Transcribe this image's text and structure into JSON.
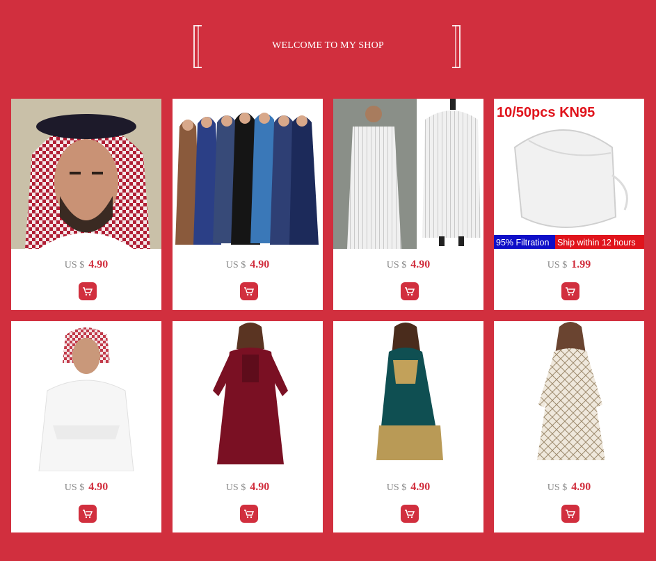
{
  "header": {
    "title": "WELCOME TO MY SHOP"
  },
  "products": [
    {
      "currency": "US $",
      "price": "4.90",
      "image": "man-red-shemagh"
    },
    {
      "currency": "US $",
      "price": "4.90",
      "image": "women-prayer-dresses"
    },
    {
      "currency": "US $",
      "price": "4.90",
      "image": "striped-thobe"
    },
    {
      "currency": "US $",
      "price": "1.99",
      "image": "kn95-mask",
      "overlay": {
        "headline": "10/50pcs KN95",
        "left_badge": "95% Filtration",
        "right_badge": "Ship within 12 hours"
      }
    },
    {
      "currency": "US $",
      "price": "4.90",
      "image": "man-white-thobe"
    },
    {
      "currency": "US $",
      "price": "4.90",
      "image": "burgundy-dress"
    },
    {
      "currency": "US $",
      "price": "4.90",
      "image": "green-velvet-dress"
    },
    {
      "currency": "US $",
      "price": "4.90",
      "image": "white-printed-dress"
    }
  ],
  "colors": {
    "background": "#d12f3e",
    "accent": "#d12f3e",
    "card": "#ffffff",
    "currency": "#888888"
  }
}
